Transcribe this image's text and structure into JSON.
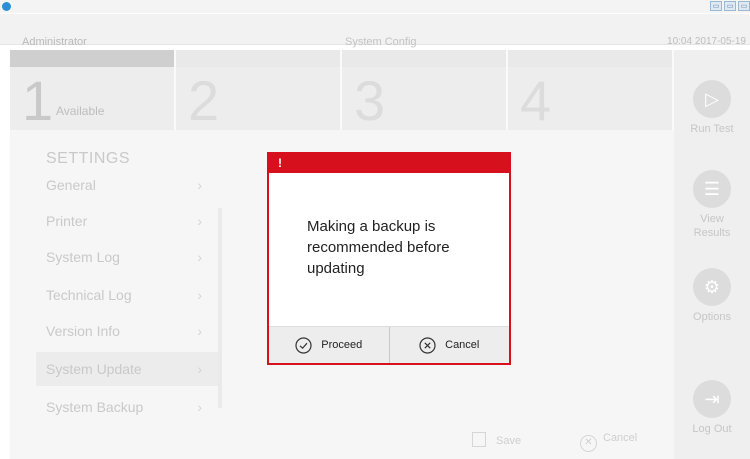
{
  "header": {
    "user": "Administrator",
    "section": "System Config",
    "datetime": "10:04 2017-05-19",
    "window_buttons": [
      "▭",
      "▭",
      "▭"
    ]
  },
  "steps": [
    {
      "number": "1",
      "label": "Available",
      "badge": "",
      "active": true
    },
    {
      "number": "2",
      "label": "",
      "badge": "",
      "active": false
    },
    {
      "number": "3",
      "label": "",
      "badge": "",
      "active": false
    },
    {
      "number": "4",
      "label": "",
      "badge": "",
      "active": false
    }
  ],
  "settings": {
    "heading": "SETTINGS",
    "items": [
      {
        "label": "General"
      },
      {
        "label": "Printer"
      },
      {
        "label": "System Log"
      },
      {
        "label": "Technical Log"
      },
      {
        "label": "Version Info"
      },
      {
        "label": "System Update",
        "active": true
      },
      {
        "label": "System Backup"
      }
    ]
  },
  "footer": {
    "save_label": "Save",
    "cancel_label": "Cancel"
  },
  "rail": {
    "run_test": "Run Test",
    "view_results": "View Results",
    "options": "Options",
    "log_out": "Log Out"
  },
  "dialog": {
    "header_symbol": "!",
    "message": "Making a backup is recommended before updating",
    "proceed_label": "Proceed",
    "cancel_label": "Cancel",
    "accent": "#d7101d"
  }
}
